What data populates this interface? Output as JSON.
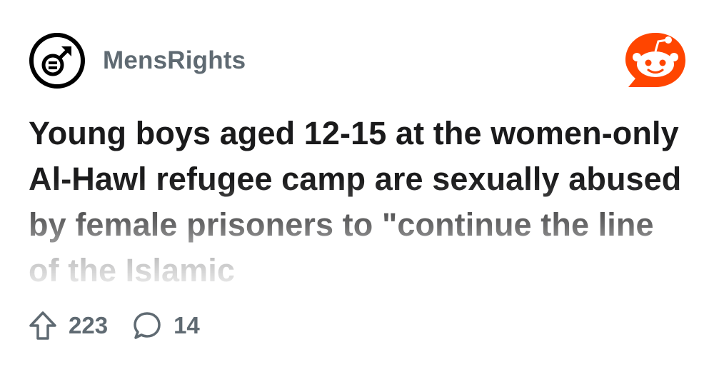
{
  "community": {
    "name": "MensRights",
    "icon": "mens-rights-symbol-icon"
  },
  "brand": {
    "logo": "reddit-snoo-icon",
    "accent_color": "#ff4500"
  },
  "post": {
    "title": "Young boys aged 12-15 at the women-only Al-Hawl refugee camp are sexually abused by female prisoners to \"continue the line of the Islamic"
  },
  "stats": {
    "upvotes": "223",
    "comments": "14",
    "upvote_icon": "upvote-arrow-icon",
    "comment_icon": "comment-bubble-icon"
  }
}
